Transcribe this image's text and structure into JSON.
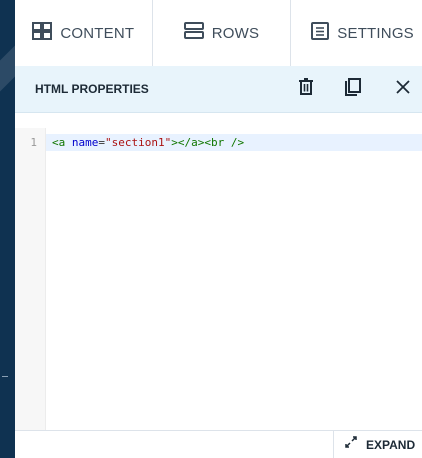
{
  "tabs": [
    {
      "label": "CONTENT",
      "icon": "grid-icon",
      "active": true
    },
    {
      "label": "ROWS",
      "icon": "rows-icon",
      "active": false
    },
    {
      "label": "SETTINGS",
      "icon": "settings-list-icon",
      "active": false
    }
  ],
  "header": {
    "title": "HTML PROPERTIES",
    "actions": [
      "delete-icon",
      "duplicate-icon",
      "close-icon"
    ]
  },
  "editor": {
    "line_number": "1",
    "code": {
      "t1": "<a ",
      "a1": "name",
      "eq": "=",
      "s1": "\"section1\"",
      "t2": "></a><br />"
    }
  },
  "footer": {
    "expand_label": "EXPAND",
    "expand_icon": "expand-arrows-icon"
  },
  "colors": {
    "background": "#0f3251",
    "header_bg": "#e8f4fb",
    "text": "#1d2a36"
  }
}
